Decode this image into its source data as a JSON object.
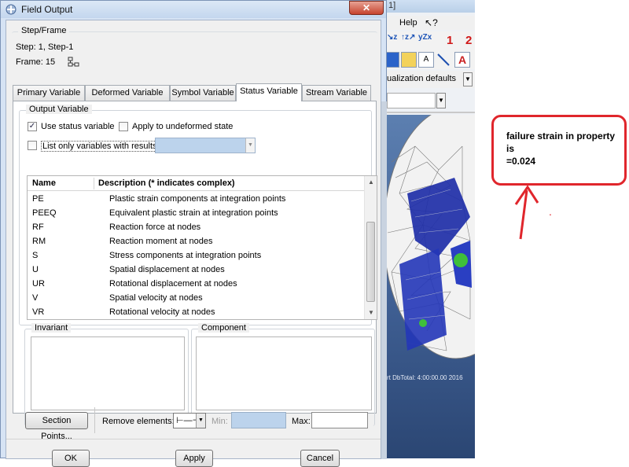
{
  "background_app": {
    "title_fragment": "1]",
    "menu_help": "Help",
    "menu_help_icon": "?",
    "toolbar_numbers": [
      "1",
      "2"
    ],
    "visualization_label": "ualization defaults",
    "viewport_caption": "rt DbTotal: 4:00:00.00 2016",
    "colors": {
      "viewport_top": "#5c7fb0",
      "mesh_blue": "#1f2fa8",
      "mesh_green": "#3fbf3a"
    }
  },
  "annotation": {
    "lines": [
      "failure strain in property",
      "is",
      "=0.024"
    ],
    "dot": ".",
    "color": "#e0262c"
  },
  "dialog": {
    "title": "Field Output",
    "close_label": "✕",
    "step_frame": {
      "legend": "Step/Frame",
      "step_text": "Step:  1, Step-1",
      "frame_text": "Frame:  15"
    },
    "tabs": [
      "Primary Variable",
      "Deformed Variable",
      "Symbol Variable",
      "Status Variable",
      "Stream Variable"
    ],
    "active_tab": "Status Variable",
    "output_variable": {
      "legend": "Output Variable",
      "use_status_label": "Use status variable",
      "use_status_checked": true,
      "apply_undeformed_label": "Apply to undeformed state",
      "apply_undeformed_checked": false,
      "list_only_label": "List only variables with results:",
      "list_only_checked": false,
      "list_only_value": ""
    },
    "variable_list": {
      "headers": [
        "Name",
        "Description (* indicates complex)"
      ],
      "rows": [
        {
          "name": "PE",
          "desc": "Plastic strain components at integration points"
        },
        {
          "name": "PEEQ",
          "desc": "Equivalent plastic strain at integration points"
        },
        {
          "name": "RF",
          "desc": "Reaction force at nodes"
        },
        {
          "name": "RM",
          "desc": "Reaction moment at nodes"
        },
        {
          "name": "S",
          "desc": "Stress components at integration points"
        },
        {
          "name": "U",
          "desc": "Spatial displacement at nodes"
        },
        {
          "name": "UR",
          "desc": "Rotational displacement at nodes"
        },
        {
          "name": "V",
          "desc": "Spatial velocity at nodes"
        },
        {
          "name": "VR",
          "desc": "Rotational velocity at nodes"
        }
      ]
    },
    "invariant_legend": "Invariant",
    "component_legend": "Component",
    "section_points_label": "Section Points...",
    "remove_elements_label": "Remove elements:",
    "remove_elements_value": "⊢—⊣",
    "min_label": "Min:",
    "max_label": "Max:",
    "min_value": "",
    "max_value": "",
    "buttons": {
      "ok": "OK",
      "apply": "Apply",
      "cancel": "Cancel"
    }
  }
}
